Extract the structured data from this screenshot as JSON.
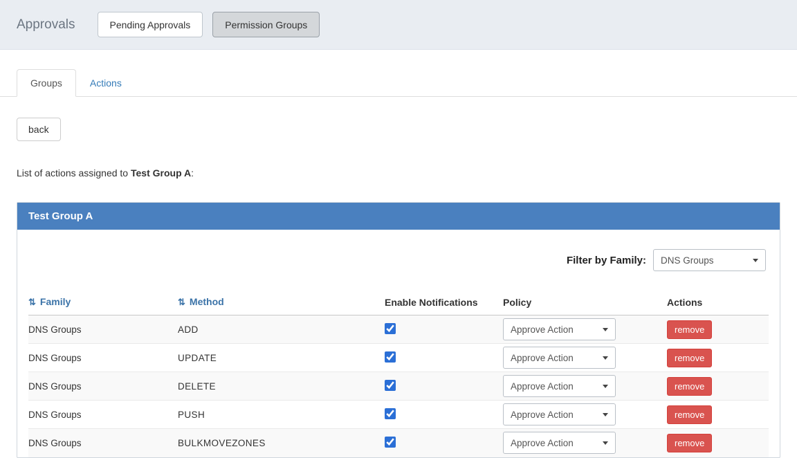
{
  "topbar": {
    "title": "Approvals",
    "pending_button": "Pending Approvals",
    "permission_button": "Permission Groups"
  },
  "tabs": {
    "groups": "Groups",
    "actions": "Actions"
  },
  "back_button": "back",
  "intro": {
    "prefix": "List of actions assigned to",
    "group": "Test Group A",
    "suffix": ":"
  },
  "panel": {
    "title": "Test Group A",
    "filter_label": "Filter by Family:",
    "filter_value": "DNS Groups"
  },
  "table": {
    "sort_icon": "⇅",
    "headers": {
      "family": "Family",
      "method": "Method",
      "notifications": "Enable Notifications",
      "policy": "Policy",
      "actions": "Actions"
    },
    "remove_label": "remove",
    "rows": [
      {
        "family": "DNS Groups",
        "method": "ADD",
        "notifications": true,
        "policy": "Approve Action"
      },
      {
        "family": "DNS Groups",
        "method": "UPDATE",
        "notifications": true,
        "policy": "Approve Action"
      },
      {
        "family": "DNS Groups",
        "method": "DELETE",
        "notifications": true,
        "policy": "Approve Action"
      },
      {
        "family": "DNS Groups",
        "method": "PUSH",
        "notifications": true,
        "policy": "Approve Action"
      },
      {
        "family": "DNS Groups",
        "method": "BULKMOVEZONES",
        "notifications": true,
        "policy": "Approve Action"
      }
    ]
  },
  "colors": {
    "panel_header": "#4a80bf",
    "danger": "#d9534f",
    "link_blue": "#337ab7",
    "topbar_bg": "#e9edf2"
  }
}
